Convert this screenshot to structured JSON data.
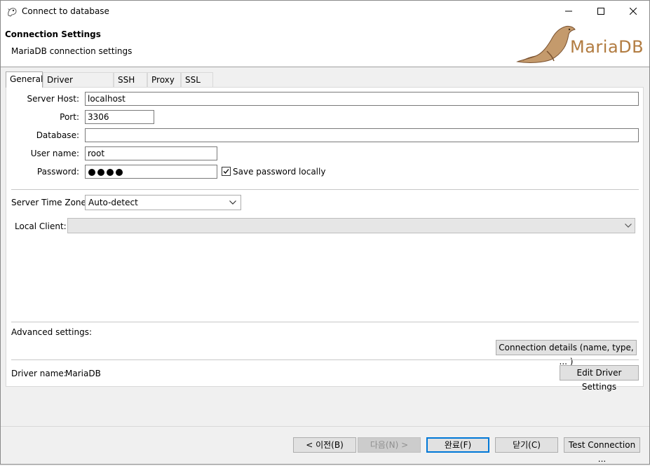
{
  "window": {
    "title": "Connect to database"
  },
  "header": {
    "title": "Connection Settings",
    "subtitle": "MariaDB connection settings",
    "logo_text": "MariaDB"
  },
  "tabs": [
    {
      "label": "General"
    },
    {
      "label": "Driver properties"
    },
    {
      "label": "SSH"
    },
    {
      "label": "Proxy"
    },
    {
      "label": "SSL"
    }
  ],
  "form": {
    "server_host_label": "Server Host:",
    "server_host_value": "localhost",
    "port_label": "Port:",
    "port_value": "3306",
    "database_label": "Database:",
    "database_value": "",
    "user_name_label": "User name:",
    "user_name_value": "root",
    "password_label": "Password:",
    "password_dots": 4,
    "save_password_label": "Save password locally",
    "save_password_checked": true,
    "time_zone_label": "Server Time Zone:",
    "time_zone_value": "Auto-detect",
    "local_client_label": "Local Client:",
    "local_client_value": ""
  },
  "advanced": {
    "label": "Advanced settings:",
    "connection_details_button": "Connection details (name, type, ... )"
  },
  "driver": {
    "label": "Driver name:",
    "value": "MariaDB",
    "edit_button": "Edit Driver Settings"
  },
  "footer": {
    "back_button": "< 이전(B)",
    "next_button": "다음(N) >",
    "finish_button": "완료(F)",
    "close_button": "닫기(C)",
    "test_button": "Test Connection ..."
  },
  "colors": {
    "accent": "#0078d7",
    "logo_brown": "#b27c41",
    "seal": "#c49a6c"
  }
}
